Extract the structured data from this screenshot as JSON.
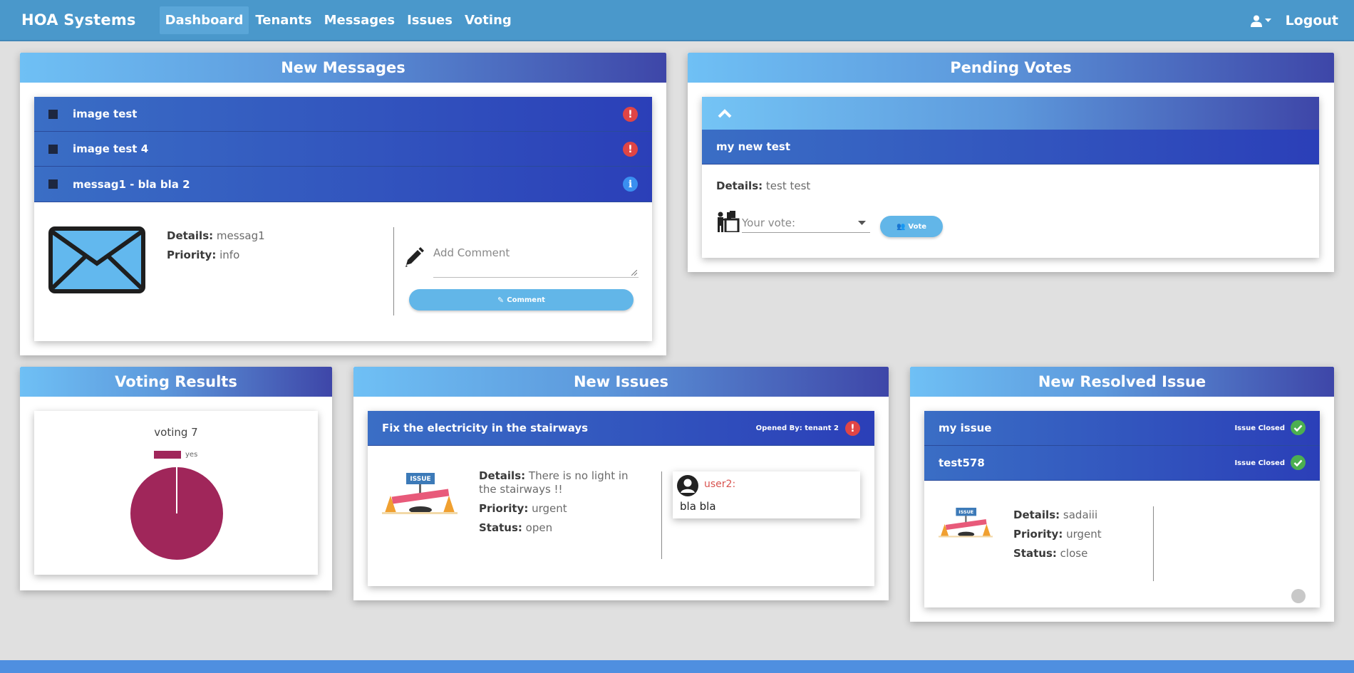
{
  "navbar": {
    "brand": "HOA Systems",
    "links": [
      "Dashboard",
      "Tenants",
      "Messages",
      "Issues",
      "Voting"
    ],
    "active": "Dashboard",
    "logout": "Logout"
  },
  "messages": {
    "title": "New Messages",
    "items": [
      {
        "title": "image test",
        "status_icon": "exclamation-icon"
      },
      {
        "title": "image test 4",
        "status_icon": "exclamation-icon"
      },
      {
        "title": "messag1 - bla bla 2",
        "status_icon": "info-icon"
      }
    ],
    "expanded": {
      "details_label": "Details:",
      "details": "messag1",
      "priority_label": "Priority:",
      "priority": "info",
      "comment_placeholder": "Add Comment",
      "comment_button": "Comment"
    }
  },
  "votes": {
    "title": "Pending Votes",
    "item_title": "my new test",
    "details_label": "Details:",
    "details": "test test",
    "vote_placeholder": "Your vote:",
    "vote_button": "Vote"
  },
  "results": {
    "title": "Voting Results",
    "chart_data": {
      "type": "pie",
      "title": "voting 7",
      "categories": [
        "yes"
      ],
      "values": [
        1
      ],
      "colors": [
        "#a0265a"
      ],
      "legend": "top"
    }
  },
  "issues": {
    "title": "New Issues",
    "item_title": "Fix the electricity in the stairways",
    "opened_by": "Opened By: tenant 2",
    "details_label": "Details:",
    "details": "There is no light in the stairways !!",
    "priority_label": "Priority:",
    "priority": "urgent",
    "status_label": "Status:",
    "status": "open",
    "comment_user": "user2:",
    "comment_text": "bla bla"
  },
  "resolved": {
    "title": "New Resolved Issue",
    "items": [
      {
        "title": "my issue",
        "status": "Issue Closed"
      },
      {
        "title": "test578",
        "status": "Issue Closed"
      }
    ],
    "details_label": "Details:",
    "details": "sadaiii",
    "priority_label": "Priority:",
    "priority": "urgent",
    "status_label": "Status:",
    "status": "close"
  },
  "colors": {
    "navbar": "#4a98cb",
    "accent": "#62b6e8",
    "danger": "#e04545",
    "success": "#4caf50",
    "pie": "#a0265a"
  }
}
